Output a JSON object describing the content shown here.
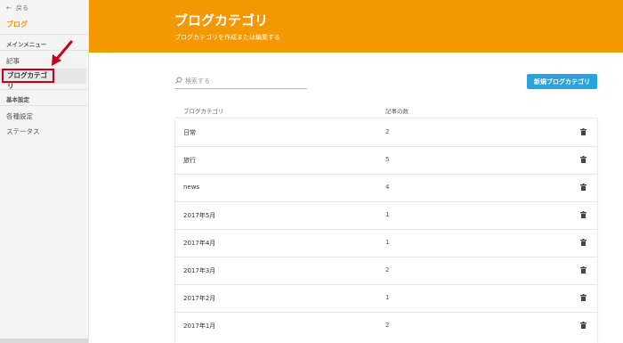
{
  "sidebar": {
    "back_label": "戻る",
    "brand": "ブログ",
    "main_menu": "メインメニュー",
    "items": [
      "記事",
      "ブログカテゴリ"
    ],
    "basic_settings": "基本設定",
    "settings_items": [
      "各種設定",
      "ステータス"
    ]
  },
  "header": {
    "title": "ブログカテゴリ",
    "subtitle": "ブログカテゴリを作成または編集する"
  },
  "search": {
    "placeholder": "検索する"
  },
  "new_button": "新規ブログカテゴリ",
  "table": {
    "columns": [
      "ブログカテゴリ",
      "記事の数"
    ],
    "rows": [
      {
        "name": "日常",
        "count": "2"
      },
      {
        "name": "旅行",
        "count": "5"
      },
      {
        "name": "news",
        "count": "4"
      },
      {
        "name": "2017年5月",
        "count": "1"
      },
      {
        "name": "2017年4月",
        "count": "1"
      },
      {
        "name": "2017年3月",
        "count": "2"
      },
      {
        "name": "2017年2月",
        "count": "1"
      },
      {
        "name": "2017年1月",
        "count": "2"
      }
    ]
  },
  "colors": {
    "accent": "#f39800",
    "button": "#29a3dc",
    "highlight": "#c3001c"
  }
}
